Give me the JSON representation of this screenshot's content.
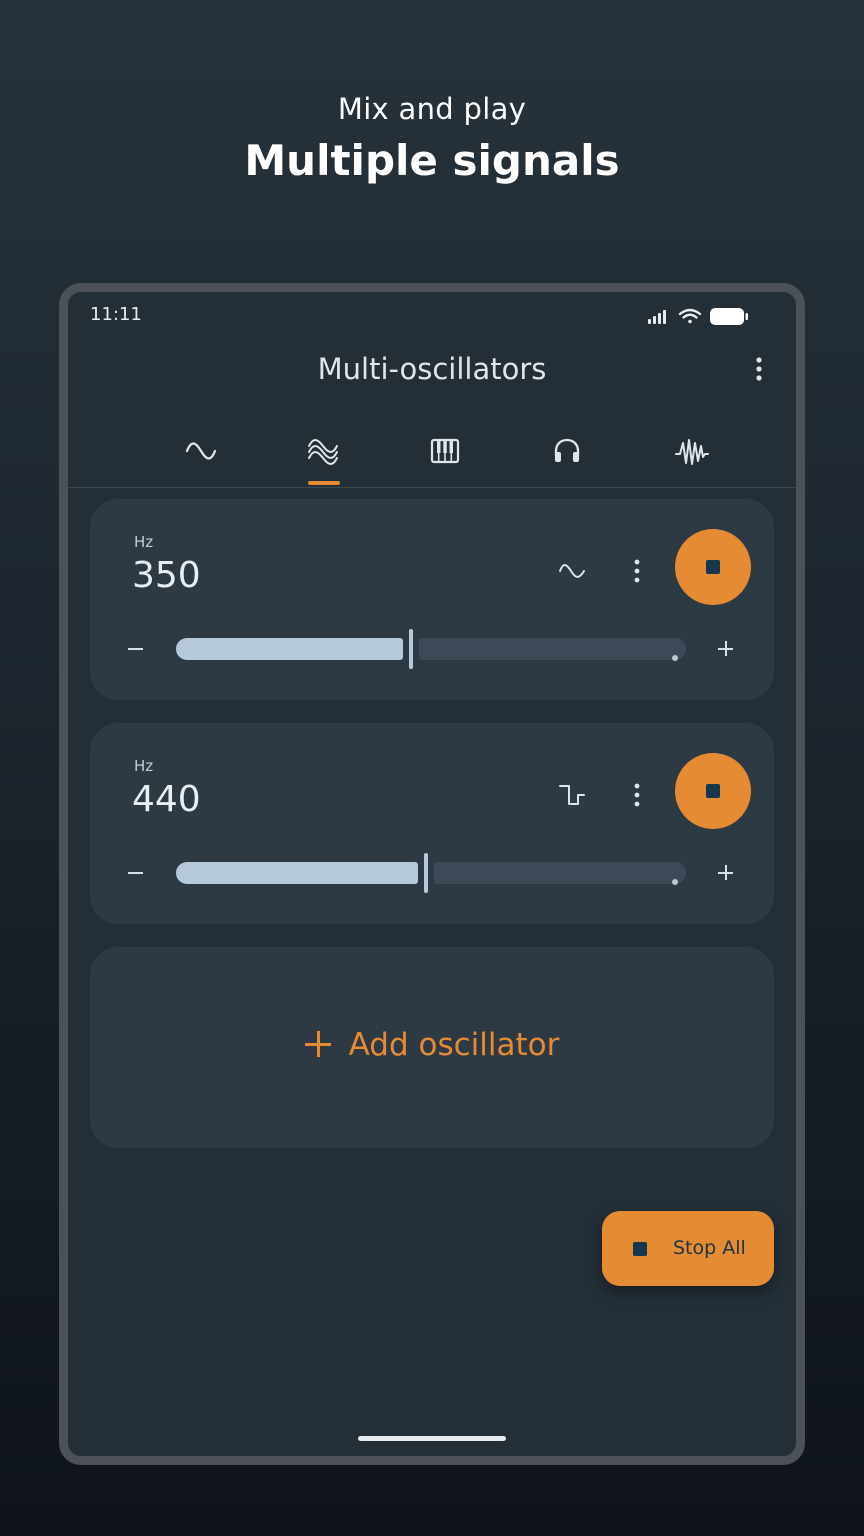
{
  "promo": {
    "subtitle": "Mix and play",
    "title": "Multiple signals"
  },
  "status_bar": {
    "time": "11:11",
    "icons": [
      "signal-icon",
      "wifi-icon",
      "battery-icon"
    ]
  },
  "app_bar": {
    "title": "Multi-oscillators"
  },
  "tabs": [
    {
      "icon": "sine-wave-icon",
      "selected": false
    },
    {
      "icon": "multi-wave-icon",
      "selected": true
    },
    {
      "icon": "piano-keys-icon",
      "selected": false
    },
    {
      "icon": "headphones-icon",
      "selected": false
    },
    {
      "icon": "noise-wave-icon",
      "selected": false
    }
  ],
  "oscillators": [
    {
      "unit": "Hz",
      "frequency": "350",
      "waveform": "sine-wave-icon",
      "playing": true,
      "slider_level": 0.46
    },
    {
      "unit": "Hz",
      "frequency": "440",
      "waveform": "square-wave-icon",
      "playing": true,
      "slider_level": 0.49
    }
  ],
  "add_oscillator": {
    "label": "Add oscillator"
  },
  "stop_all": {
    "label": "Stop All"
  },
  "colors": {
    "accent": "#e48b33",
    "card": "#2d3943",
    "screen": "#232e37",
    "slider": "#b6cadb",
    "stop_square": "#16384c"
  }
}
